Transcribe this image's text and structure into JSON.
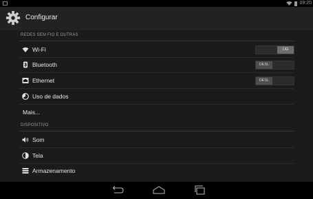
{
  "status_bar": {
    "time": "09:20"
  },
  "action_bar": {
    "title": "Configurar",
    "icon": "settings-gear-icon"
  },
  "sections": [
    {
      "header": "REDES SEM FIO E OUTRAS",
      "items": [
        {
          "label": "Wi-Fi",
          "icon": "wifi-icon",
          "switch": "LIG"
        },
        {
          "label": "Bluetooth",
          "icon": "bluetooth-icon",
          "switch": "DESL"
        },
        {
          "label": "Ethernet",
          "icon": "ethernet-icon",
          "switch": "DESL"
        },
        {
          "label": "Uso de dados",
          "icon": "data-usage-icon"
        },
        {
          "label": "Mais..."
        }
      ]
    },
    {
      "header": "DISPOSITIVO",
      "items": [
        {
          "label": "Som",
          "icon": "sound-icon"
        },
        {
          "label": "Tela",
          "icon": "display-icon"
        },
        {
          "label": "Armazenamento",
          "icon": "storage-icon"
        }
      ]
    }
  ],
  "colors": {
    "background": "#1b1b1b",
    "action_bar": "#222222",
    "nav_bar": "#000000"
  }
}
